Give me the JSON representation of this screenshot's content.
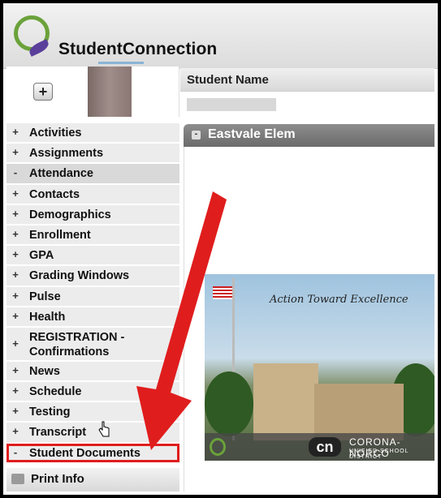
{
  "app": {
    "brand": "StudentConnection"
  },
  "student": {
    "name_header": "Student Name"
  },
  "menu": {
    "items": [
      {
        "sym": "+",
        "label": "Activities"
      },
      {
        "sym": "+",
        "label": "Assignments"
      },
      {
        "sym": "-",
        "label": "Attendance"
      },
      {
        "sym": "+",
        "label": "Contacts"
      },
      {
        "sym": "+",
        "label": "Demographics"
      },
      {
        "sym": "+",
        "label": "Enrollment"
      },
      {
        "sym": "+",
        "label": "GPA"
      },
      {
        "sym": "+",
        "label": "Grading Windows"
      },
      {
        "sym": "+",
        "label": "Pulse"
      },
      {
        "sym": "+",
        "label": "Health"
      },
      {
        "sym": "+",
        "label": "REGISTRATION - Confirmations"
      },
      {
        "sym": "+",
        "label": "News"
      },
      {
        "sym": "+",
        "label": "Schedule"
      },
      {
        "sym": "+",
        "label": "Testing"
      },
      {
        "sym": "+",
        "label": "Transcript"
      },
      {
        "sym": "-",
        "label": "Student Documents"
      }
    ],
    "print_label": "Print Info"
  },
  "school": {
    "name": "Eastvale Elem",
    "motto": "Action Toward Excellence",
    "district_mark": "cn",
    "district_name": "CORONA-NORCO",
    "district_sub": "UNIFIED SCHOOL DISTRICT"
  },
  "colors": {
    "highlight": "#e01d1d",
    "arrow": "#e01d1d",
    "logo_green": "#6aa23a"
  }
}
